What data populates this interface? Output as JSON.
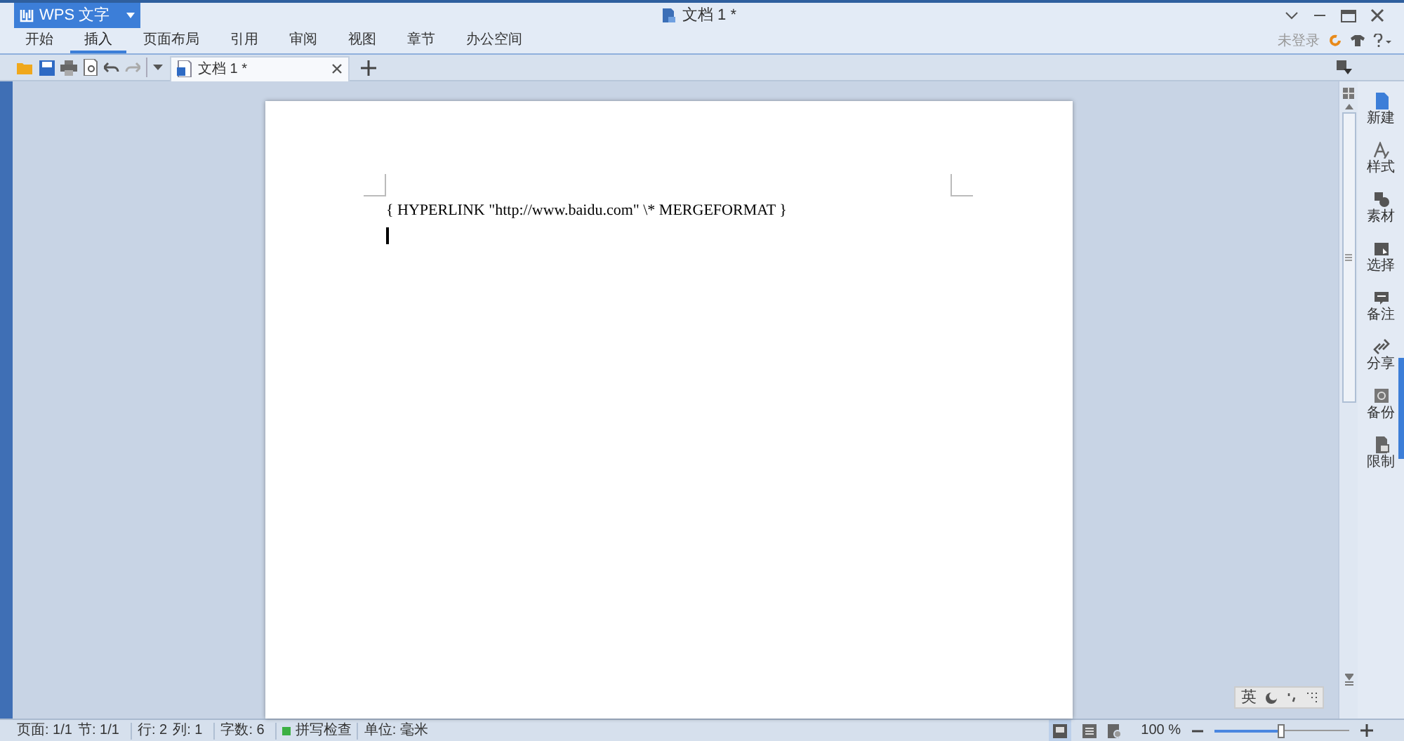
{
  "window": {
    "app_button": "WPS 文字",
    "title": "文档 1 *"
  },
  "menu_tabs": [
    {
      "label": "开始",
      "selected": false
    },
    {
      "label": "插入",
      "selected": true
    },
    {
      "label": "页面布局",
      "selected": false
    },
    {
      "label": "引用",
      "selected": false
    },
    {
      "label": "审阅",
      "selected": false
    },
    {
      "label": "视图",
      "selected": false
    },
    {
      "label": "章节",
      "selected": false
    },
    {
      "label": "办公空间",
      "selected": false
    }
  ],
  "account": {
    "status": "未登录"
  },
  "document_tabs": [
    {
      "label": "文档 1 *",
      "selected": true
    }
  ],
  "document": {
    "field_code": "{ HYPERLINK \"http://www.baidu.com\" \\* MERGEFORMAT }"
  },
  "side_panel": [
    {
      "kind": "new",
      "label": "新建"
    },
    {
      "kind": "style",
      "label": "样式"
    },
    {
      "kind": "material",
      "label": "素材"
    },
    {
      "kind": "select",
      "label": "选择"
    },
    {
      "kind": "comment",
      "label": "备注"
    },
    {
      "kind": "share",
      "label": "分享"
    },
    {
      "kind": "backup",
      "label": "备份"
    },
    {
      "kind": "restrict",
      "label": "限制"
    }
  ],
  "ime_bar": {
    "mode": "英"
  },
  "status_bar": {
    "items": [
      "页面: 1/1",
      "节: 1/1",
      "行: 2",
      "列: 1",
      "字数: 6"
    ],
    "spell_check": "拼写检查",
    "unit": "单位: 毫米"
  },
  "zoom": {
    "reading": "100 %",
    "level": 0.5
  }
}
